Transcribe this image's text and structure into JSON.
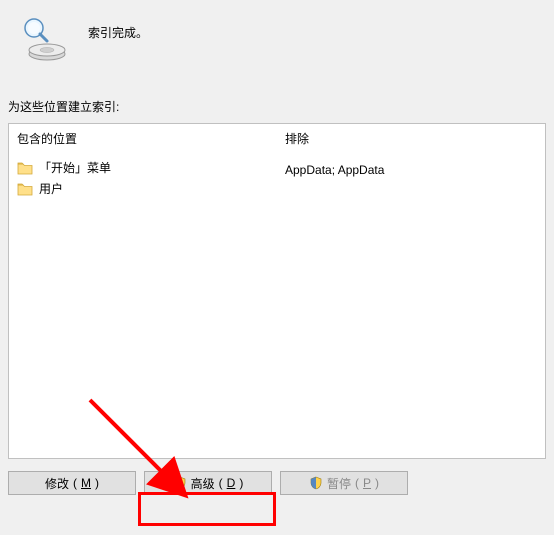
{
  "status": {
    "text": "索引完成。"
  },
  "locations_section": {
    "label": "为这些位置建立索引:",
    "columns": {
      "included": "包含的位置",
      "excluded": "排除"
    },
    "items": [
      {
        "name": "「开始」菜单",
        "exclude": ""
      },
      {
        "name": "用户",
        "exclude": "AppData; AppData"
      }
    ]
  },
  "buttons": {
    "modify": {
      "label": "修改",
      "accel": "M"
    },
    "advanced": {
      "label": "高级",
      "accel": "D"
    },
    "pause": {
      "label": "暂停",
      "accel": "P"
    }
  }
}
